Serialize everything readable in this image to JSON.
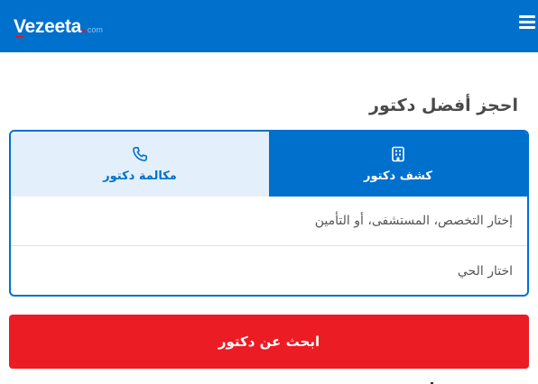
{
  "header": {
    "logo_text": "Vezeeta",
    "logo_suffix": "com",
    "menu_icon": "hamburger-menu-icon",
    "background_color": "#0070cd"
  },
  "main": {
    "title": "احجز أفضل دكتور",
    "tabs": [
      {
        "label": "كشف دكتور",
        "icon": "building-icon",
        "active": true
      },
      {
        "label": "مكالمة دكتور",
        "icon": "phone-icon",
        "active": false
      }
    ],
    "specialty_placeholder": "إختار التخصص، المستشفى، أو التأمين",
    "area_placeholder": "اختار الحي",
    "search_button_label": "ابحث عن دكتور",
    "accent_color": "#0070cd",
    "button_color": "#ec1c24"
  }
}
